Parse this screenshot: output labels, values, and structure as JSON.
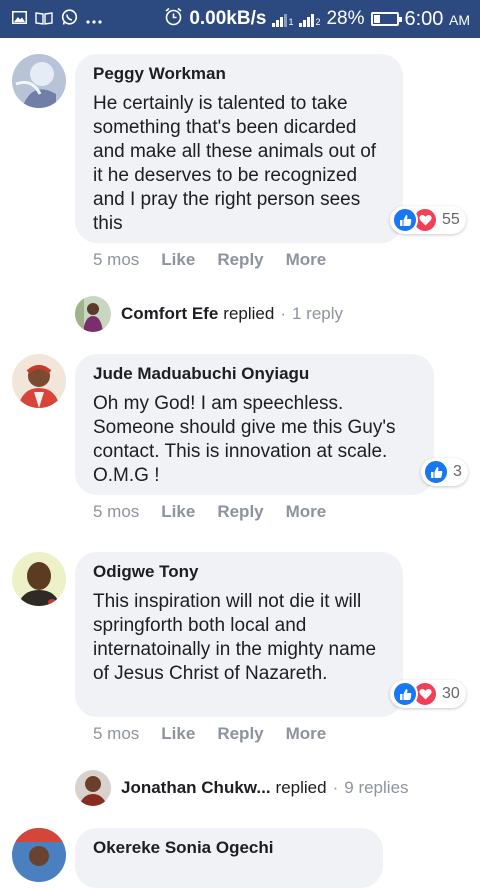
{
  "status_bar": {
    "network_speed": "0.00kB/s",
    "battery": "28%",
    "battery_level": 0.28,
    "time": "6:00",
    "ampm": "AM",
    "sim1": "1",
    "sim2": "2"
  },
  "comments": [
    {
      "name": "Peggy Workman",
      "text": "He certainly is talented to take something that's been dicarded and make all these animals out of it he deserves to be recognized and I pray the right person sees this",
      "reactions": {
        "types": [
          "like",
          "love"
        ],
        "count": "55"
      },
      "time": "5 mos",
      "like": "Like",
      "reply": "Reply",
      "more": "More",
      "replies_summary": {
        "name": "Comfort Efe",
        "replied": "replied",
        "dot": "·",
        "count": "1 reply"
      }
    },
    {
      "name": "Jude Maduabuchi Onyiagu",
      "text": "Oh my God! I am speechless. Someone should give me this Guy's contact. This is innovation at scale. O.M.G !",
      "reactions": {
        "types": [
          "like"
        ],
        "count": "3"
      },
      "time": "5 mos",
      "like": "Like",
      "reply": "Reply",
      "more": "More"
    },
    {
      "name": "Odigwe Tony",
      "text": "This inspiration will not die it will springforth both local and internatoinally in the mighty name of Jesus Christ of Nazareth.",
      "reactions": {
        "types": [
          "like",
          "love"
        ],
        "count": "30"
      },
      "time": "5 mos",
      "like": "Like",
      "reply": "Reply",
      "more": "More",
      "replies_summary": {
        "name": "Jonathan Chukw...",
        "replied": "replied",
        "dot": "·",
        "count": "9 replies"
      }
    },
    {
      "name": "Okereke Sonia Ogechi"
    }
  ],
  "colors": {
    "status_bar_bg": "#2c4a80",
    "bubble_bg": "#f0f2f5",
    "like_blue": "#1877f2",
    "love_red": "#f33e58",
    "meta_gray": "#8d949e"
  }
}
